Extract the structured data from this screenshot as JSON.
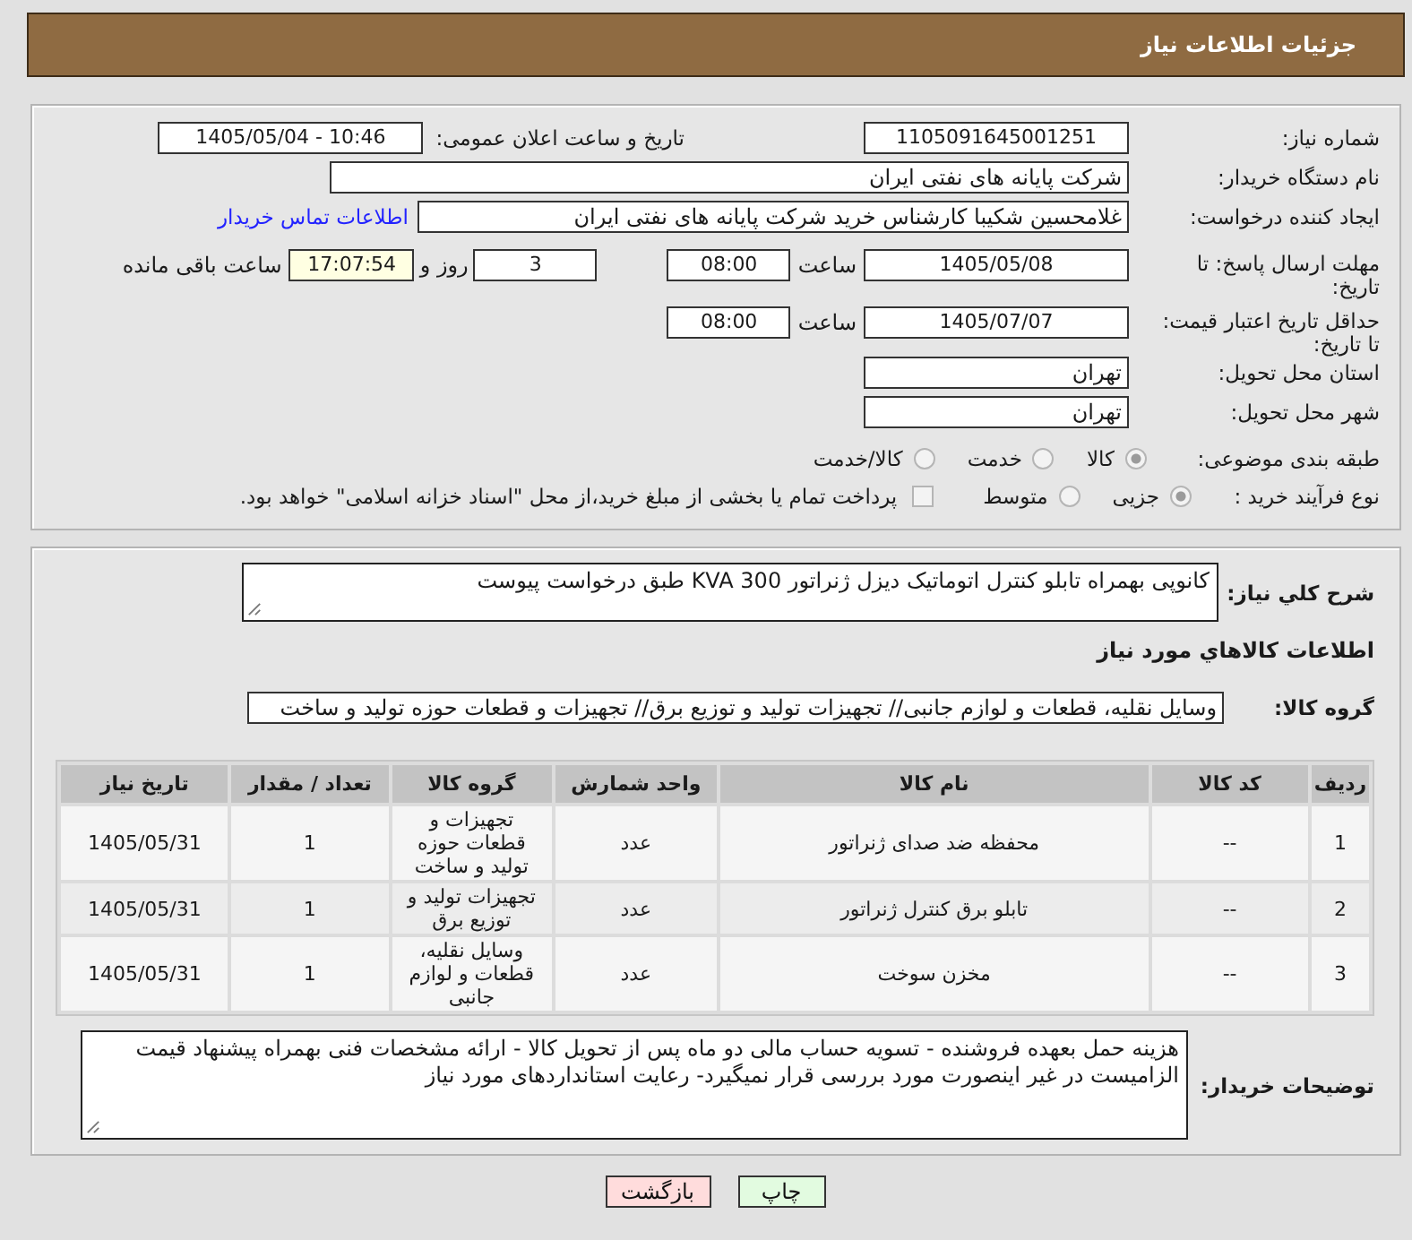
{
  "header": {
    "title": "جزئیات اطلاعات نیاز"
  },
  "form": {
    "need_number": {
      "label": "شماره نیاز:",
      "value": "1105091645001251"
    },
    "announce_datetime": {
      "label": "تاریخ و ساعت اعلان عمومی:",
      "value": "1405/05/04 - 10:46"
    },
    "buyer_org": {
      "label": "نام دستگاه خریدار:",
      "value": "شرکت پایانه های نفتی ایران"
    },
    "requester": {
      "label": "ایجاد کننده درخواست:",
      "value": "غلامحسین شکیبا کارشناس خرید شرکت پایانه های نفتی ایران",
      "link": "اطلاعات تماس خریدار"
    },
    "reply_deadline": {
      "label": "مهلت ارسال پاسخ: تا تاریخ:",
      "date": "1405/05/08",
      "time_label": "ساعت",
      "time": "08:00",
      "days": "3",
      "days_label": "روز و",
      "remaining": "17:07:54",
      "remaining_label": "ساعت باقی مانده"
    },
    "price_validity": {
      "label": "حداقل تاریخ اعتبار قیمت: تا تاریخ:",
      "date": "1405/07/07",
      "time_label": "ساعت",
      "time": "08:00"
    },
    "province": {
      "label": "استان محل تحویل:",
      "value": "تهران"
    },
    "city": {
      "label": "شهر محل تحویل:",
      "value": "تهران"
    },
    "category": {
      "label": "طبقه بندی موضوعی:",
      "options": [
        {
          "label": "کالا",
          "selected": true
        },
        {
          "label": "خدمت",
          "selected": false
        },
        {
          "label": "کالا/خدمت",
          "selected": false
        }
      ]
    },
    "process": {
      "label": "نوع فرآیند خرید :",
      "options": [
        {
          "label": "جزیی",
          "selected": true
        },
        {
          "label": "متوسط",
          "selected": false
        }
      ],
      "treasury": {
        "label": "پرداخت تمام یا بخشی از مبلغ خرید،از محل \"اسناد خزانه اسلامی\" خواهد بود.",
        "checked": false
      }
    }
  },
  "details": {
    "summary": {
      "label": "شرح کلي نیاز:",
      "value": "کانوپی بهمراه تابلو کنترل اتوماتیک دیزل ژنراتور 300 KVA طبق درخواست پیوست"
    },
    "goods_title": "اطلاعات کالاهاي مورد نیاز",
    "goods_group": {
      "label": "گروه کالا:",
      "value": "وسایل نقلیه، قطعات و لوازم جانبی// تجهیزات تولید و توزیع برق// تجهیزات و قطعات حوزه تولید و ساخت"
    },
    "table": {
      "columns": [
        "ردیف",
        "کد کالا",
        "نام کالا",
        "واحد شمارش",
        "گروه کالا",
        "تعداد / مقدار",
        "تاریخ نیاز"
      ],
      "rows": [
        [
          "1",
          "--",
          "محفظه ضد صدای ژنراتور",
          "عدد",
          "تجهیزات و قطعات حوزه تولید و ساخت",
          "1",
          "1405/05/31"
        ],
        [
          "2",
          "--",
          "تابلو برق کنترل ژنراتور",
          "عدد",
          "تجهیزات تولید و توزیع برق",
          "1",
          "1405/05/31"
        ],
        [
          "3",
          "--",
          "مخزن سوخت",
          "عدد",
          "وسایل نقلیه، قطعات و لوازم جانبی",
          "1",
          "1405/05/31"
        ]
      ]
    },
    "buyer_notes": {
      "label": "توضیحات خریدار:",
      "value": "هزینه حمل بعهده فروشنده - تسویه حساب مالی دو ماه پس از تحویل کالا - ارائه مشخصات فنی بهمراه پیشنهاد قیمت الزامیست در غیر اینصورت مورد بررسی قرار نمیگیرد- رعایت استانداردهای مورد نیاز"
    }
  },
  "buttons": [
    {
      "label": "چاپ",
      "kind": "print"
    },
    {
      "label": "بازگشت",
      "kind": "back"
    }
  ]
}
